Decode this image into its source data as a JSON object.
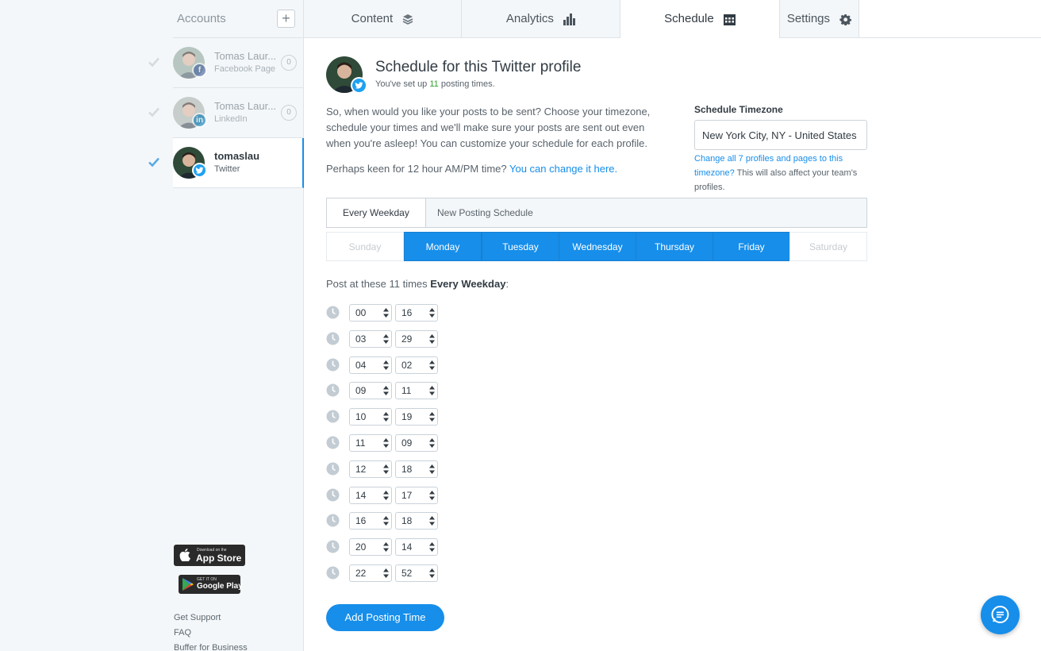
{
  "sidebar": {
    "accounts_title": "Accounts",
    "add_symbol": "+",
    "profiles": [
      {
        "name": "Tomas Laur...",
        "type": "Facebook Page",
        "count": "0",
        "network_badge": "f"
      },
      {
        "name": "Tomas Laur...",
        "type": "LinkedIn",
        "count": "0",
        "network_badge": "in"
      },
      {
        "name": "tomaslau",
        "type": "Twitter",
        "network_badge": "twitter-bird-icon"
      }
    ],
    "app_store": {
      "small": "Download on the",
      "big": "App Store"
    },
    "google_play": {
      "small": "GET IT ON",
      "big": "Google Play"
    },
    "footer_links": [
      "Get Support",
      "FAQ",
      "Buffer for Business"
    ]
  },
  "tabs": [
    {
      "label": "Content",
      "icon": "layers-icon"
    },
    {
      "label": "Analytics",
      "icon": "bar-chart-icon"
    },
    {
      "label": "Schedule",
      "icon": "calendar-icon",
      "active": true
    },
    {
      "label": "Settings",
      "icon": "gear-icon"
    }
  ],
  "header": {
    "title": "Schedule for this Twitter profile",
    "sub_prefix": "You've set up ",
    "sub_count": "11",
    "sub_suffix": " posting times."
  },
  "intro": {
    "text": "So, when would you like your posts to be sent? Choose your timezone, schedule your times and we'll make sure your posts are sent out even when you're asleep! You can customize your schedule for each profile.",
    "ampm_prefix": "Perhaps keen for 12 hour AM/PM time? ",
    "ampm_link": "You can change it here."
  },
  "timezone": {
    "label": "Schedule Timezone",
    "value": "New York City, NY - United States",
    "note_link": "Change all 7 profiles and pages to this timezone?",
    "note_rest": " This will also affect your team's profiles."
  },
  "schedule_tabs": [
    "Every Weekday",
    "New Posting Schedule"
  ],
  "days": [
    {
      "label": "Sunday",
      "on": false
    },
    {
      "label": "Monday",
      "on": true
    },
    {
      "label": "Tuesday",
      "on": true
    },
    {
      "label": "Wednesday",
      "on": true
    },
    {
      "label": "Thursday",
      "on": true
    },
    {
      "label": "Friday",
      "on": true
    },
    {
      "label": "Saturday",
      "on": false
    }
  ],
  "post_label": {
    "prefix": "Post at these 11 times ",
    "bold": "Every Weekday",
    "suffix": ":"
  },
  "times": [
    {
      "hour": "00",
      "minute": "16"
    },
    {
      "hour": "03",
      "minute": "29"
    },
    {
      "hour": "04",
      "minute": "02"
    },
    {
      "hour": "09",
      "minute": "11"
    },
    {
      "hour": "10",
      "minute": "19"
    },
    {
      "hour": "11",
      "minute": "09"
    },
    {
      "hour": "12",
      "minute": "18"
    },
    {
      "hour": "14",
      "minute": "17"
    },
    {
      "hour": "16",
      "minute": "18"
    },
    {
      "hour": "20",
      "minute": "14"
    },
    {
      "hour": "22",
      "minute": "52"
    }
  ],
  "add_button": "Add Posting Time",
  "colors": {
    "accent": "#168eea",
    "count_green": "#2fa12d",
    "twitter": "#1da1f2",
    "facebook": "#3b5998",
    "linkedin": "#0077b5"
  }
}
